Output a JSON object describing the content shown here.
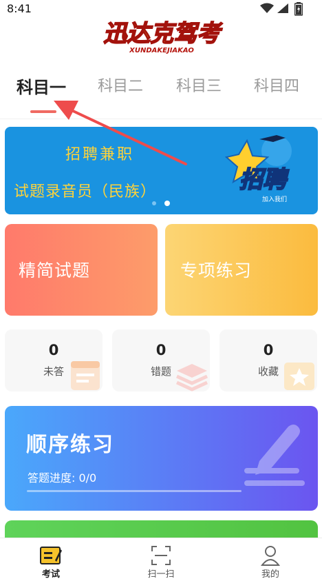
{
  "status_bar": {
    "time": "8:41"
  },
  "app": {
    "logo_text": "迅达克驾考",
    "logo_subtext": "XUNDAKEJIAKAO"
  },
  "tabs": [
    {
      "label": "科目一",
      "active": true
    },
    {
      "label": "科目二",
      "active": false
    },
    {
      "label": "科目三",
      "active": false
    },
    {
      "label": "科目四",
      "active": false
    }
  ],
  "banner": {
    "line1": "招聘兼职",
    "line2": "试题录音员（民族）",
    "badge_text": "招聘",
    "badge_sub": "加入我们",
    "slide_index": 2,
    "slide_count": 2
  },
  "cards": {
    "jingjian": "精简试题",
    "zhuanxiang": "专项练习"
  },
  "stats": [
    {
      "value": "0",
      "label": "未答"
    },
    {
      "value": "0",
      "label": "错题"
    },
    {
      "value": "0",
      "label": "收藏"
    }
  ],
  "sequence": {
    "title": "顺序练习",
    "progress_text": "答题进度: 0/0",
    "progress_fraction": 0
  },
  "bottom_nav": [
    {
      "label": "考试",
      "active": true
    },
    {
      "label": "扫一扫",
      "active": false
    },
    {
      "label": "我的",
      "active": false
    }
  ],
  "colors": {
    "accent": "#f06a62",
    "banner_bg": "#1a93e0",
    "banner_text": "#ffd33a",
    "nav_active_icon": "#f5c22b"
  }
}
